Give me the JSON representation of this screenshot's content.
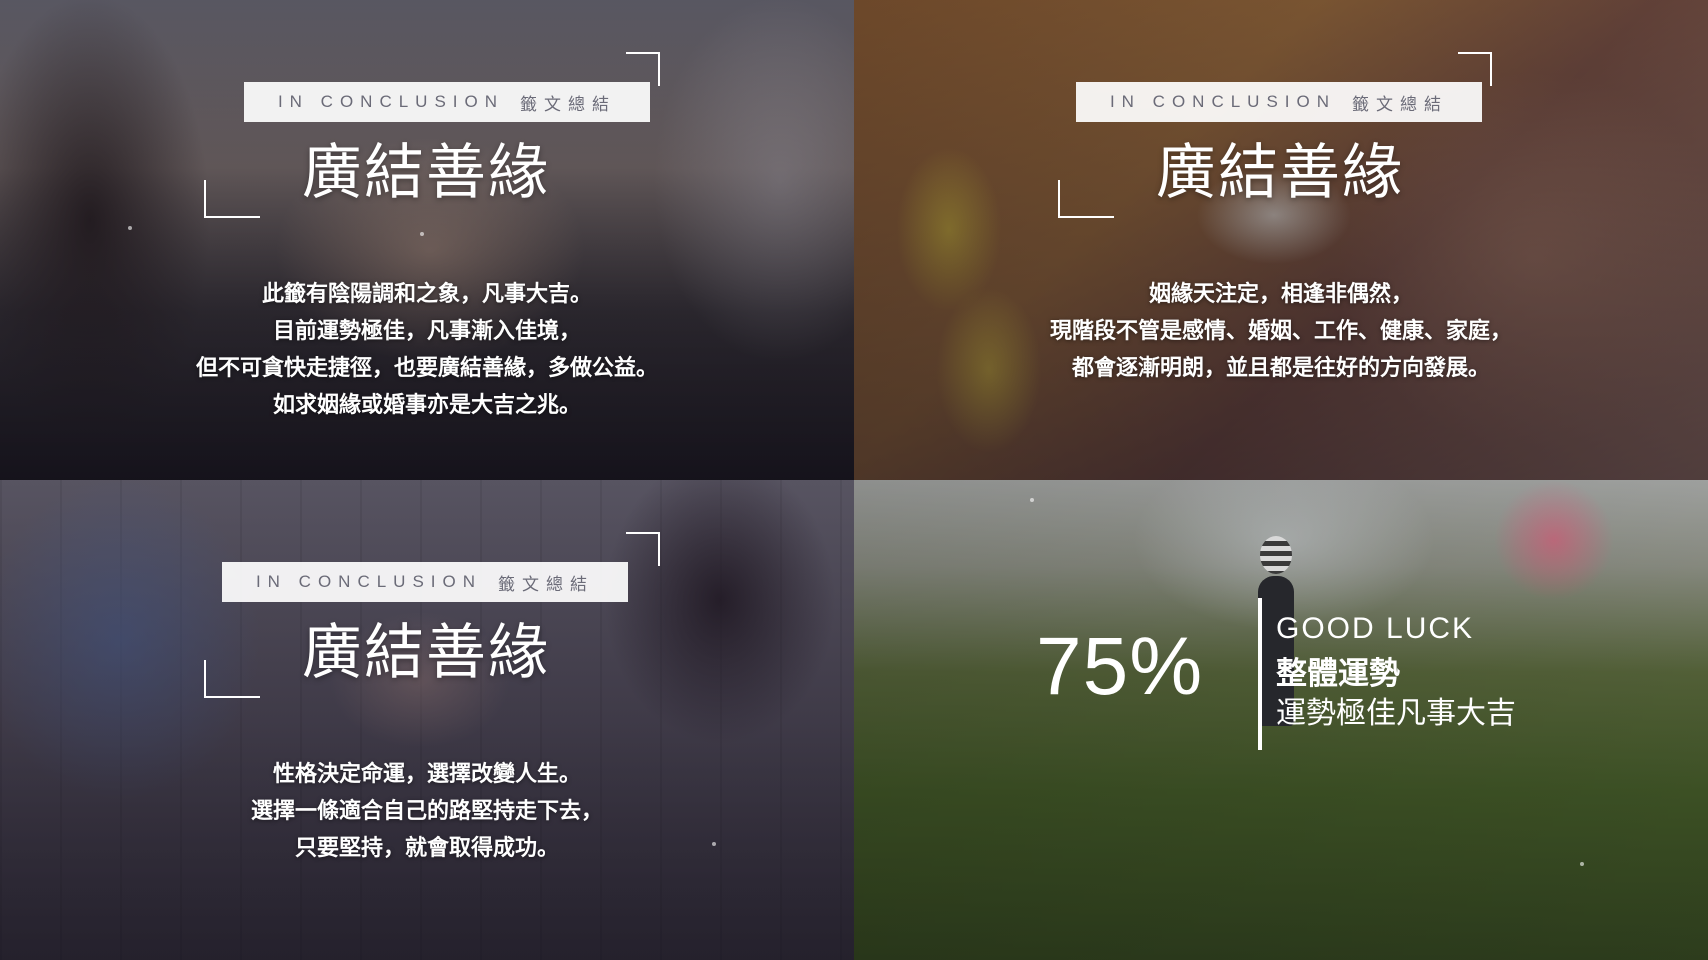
{
  "panels": [
    {
      "tag_en": "IN CONCLUSION",
      "tag_cn": "籤文總結",
      "title": "廣結善緣",
      "lines": [
        "此籤有陰陽調和之象，凡事大吉。",
        "目前運勢極佳，凡事漸入佳境，",
        "但不可貪快走捷徑，也要廣結善緣，多做公益。",
        "如求姻緣或婚事亦是大吉之兆。"
      ]
    },
    {
      "tag_en": "IN CONCLUSION",
      "tag_cn": "籤文總結",
      "title": "廣結善緣",
      "lines": [
        "姻緣天注定，相逢非偶然，",
        "現階段不管是感情、婚姻、工作、健康、家庭，",
        "都會逐漸明朗，並且都是往好的方向發展。"
      ]
    },
    {
      "tag_en": "IN CONCLUSION",
      "tag_cn": "籤文總結",
      "title": "廣結善緣",
      "lines": [
        "性格決定命運，選擇改變人生。",
        "選擇一條適合自己的路堅持走下去，",
        "只要堅持，就會取得成功。"
      ]
    }
  ],
  "fortune": {
    "percent": "75%",
    "label_en": "GOOD LUCK",
    "label_cn": "整體運勢",
    "subtitle": "運勢極佳凡事大吉"
  }
}
